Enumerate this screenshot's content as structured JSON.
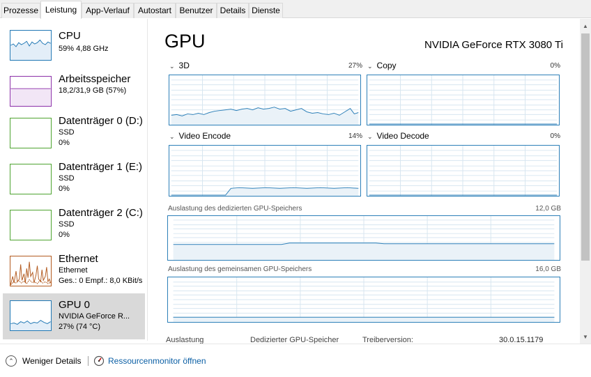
{
  "tabs": [
    "Prozesse",
    "Leistung",
    "App-Verlauf",
    "Autostart",
    "Benutzer",
    "Details",
    "Dienste"
  ],
  "sidebar": {
    "items": [
      {
        "title": "CPU",
        "sub1": "59% 4,88 GHz",
        "sub2": "",
        "sub3": "",
        "color": "#1f77b4"
      },
      {
        "title": "Arbeitsspeicher",
        "sub1": "18,2/31,9 GB (57%)",
        "sub2": "",
        "sub3": "",
        "color": "#8b2fa8"
      },
      {
        "title": "Datenträger 0 (D:)",
        "sub1": "SSD",
        "sub2": "0%",
        "sub3": "",
        "color": "#4da32f"
      },
      {
        "title": "Datenträger 1 (E:)",
        "sub1": "SSD",
        "sub2": "0%",
        "sub3": "",
        "color": "#4da32f"
      },
      {
        "title": "Datenträger 2 (C:)",
        "sub1": "SSD",
        "sub2": "0%",
        "sub3": "",
        "color": "#4da32f"
      },
      {
        "title": "Ethernet",
        "sub1": "Ethernet",
        "sub2": "Ges.: 0 Empf.: 8,0 KBit/s",
        "sub3": "",
        "color": "#b35a1f"
      },
      {
        "title": "GPU 0",
        "sub1": "NVIDIA GeForce R...",
        "sub2": "27% (74 °C)",
        "sub3": "",
        "color": "#1f77b4"
      }
    ]
  },
  "main": {
    "title": "GPU",
    "device": "NVIDIA GeForce RTX 3080 Ti",
    "engines": [
      {
        "label": "3D",
        "pct": "27%"
      },
      {
        "label": "Copy",
        "pct": "0%"
      },
      {
        "label": "Video Encode",
        "pct": "14%"
      },
      {
        "label": "Video Decode",
        "pct": "0%"
      }
    ],
    "dedicated": {
      "label": "Auslastung des dedizierten GPU-Speichers",
      "max": "12,0 GB"
    },
    "shared": {
      "label": "Auslastung des gemeinsamen GPU-Speichers",
      "max": "16,0 GB"
    },
    "footer": {
      "col1": "Auslastung",
      "col2": "Dedizierter GPU-Speicher",
      "col3": "Treiberversion:",
      "col4": "30.0.15.1179"
    }
  },
  "bottom": {
    "less_details": "Weniger Details",
    "resmon": "Ressourcenmonitor öffnen"
  },
  "colors": {
    "accent": "#2c7fb8",
    "grid": "#d7e6f0",
    "fill": "#eaf2f8"
  },
  "icons": {
    "collapse": "chevron-up-icon",
    "resmon": "resource-monitor-icon"
  }
}
